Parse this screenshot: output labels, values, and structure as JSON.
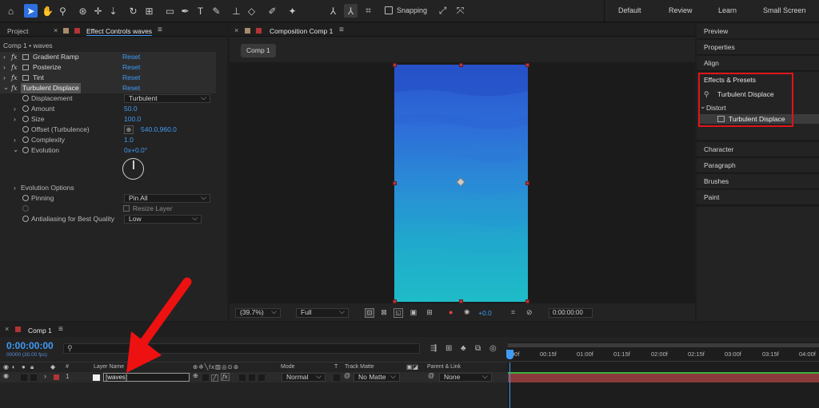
{
  "toolbar": {
    "snapping_label": "Snapping",
    "workspaces": [
      "Default",
      "Review",
      "Learn",
      "Small Screen"
    ]
  },
  "left_panel": {
    "tab_project": "Project",
    "tab_effect_controls": "Effect Controls waves",
    "breadcrumb": "Comp 1 • waves",
    "effects": [
      {
        "name": "Gradient Ramp",
        "reset": "Reset"
      },
      {
        "name": "Posterize",
        "reset": "Reset"
      },
      {
        "name": "Tint",
        "reset": "Reset"
      },
      {
        "name": "Turbulent Displace",
        "reset": "Reset"
      }
    ],
    "props": {
      "displacement": {
        "label": "Displacement",
        "value": "Turbulent"
      },
      "amount": {
        "label": "Amount",
        "value": "50.0"
      },
      "size": {
        "label": "Size",
        "value": "100.0"
      },
      "offset": {
        "label": "Offset (Turbulence)",
        "value": "540.0,960.0"
      },
      "complexity": {
        "label": "Complexity",
        "value": "1.0"
      },
      "evolution": {
        "label": "Evolution",
        "value": "0x+0.0°"
      },
      "evolution_options": {
        "label": "Evolution Options"
      },
      "pinning": {
        "label": "Pinning",
        "value": "Pin All"
      },
      "resize_layer": {
        "label": "Resize Layer"
      },
      "antialiasing": {
        "label": "Antialiasing for Best Quality",
        "value": "Low"
      }
    }
  },
  "composition": {
    "tab_label": "Composition Comp 1",
    "comp_button": "Comp 1",
    "zoom": "(39.7%)",
    "resolution": "Full",
    "exposure": "+0.0",
    "timecode": "0:00:00:00",
    "colors": {
      "top": "#2a56cc",
      "bottom": "#1fb6c8"
    }
  },
  "right_panel": {
    "items_top": [
      "Preview",
      "Properties",
      "Align"
    ],
    "effects_presets": {
      "title": "Effects & Presets",
      "search_value": "Turbulent Displace",
      "category": "Distort",
      "result": "Turbulent Displace"
    },
    "items_bottom": [
      "Character",
      "Paragraph",
      "Brushes",
      "Paint"
    ]
  },
  "timeline": {
    "tab_label": "Comp 1",
    "timecode": "0:00:00:00",
    "fps": "00000 (30.00 fps)",
    "columns": {
      "hash": "#",
      "layer_name": "Layer Name",
      "mode": "Mode",
      "t": "T",
      "track_matte": "Track Matte",
      "parent_link": "Parent & Link"
    },
    "ruler": [
      "00f",
      "00:15f",
      "01:00f",
      "01:15f",
      "02:00f",
      "02:15f",
      "03:00f",
      "03:15f",
      "04:00f"
    ],
    "layer": {
      "index": "1",
      "name": "[waves]",
      "mode": "Normal",
      "track_matte": "No Matte",
      "parent": "None"
    }
  },
  "highlight_color": "#e0141a",
  "arrow_color": "#ee1111"
}
